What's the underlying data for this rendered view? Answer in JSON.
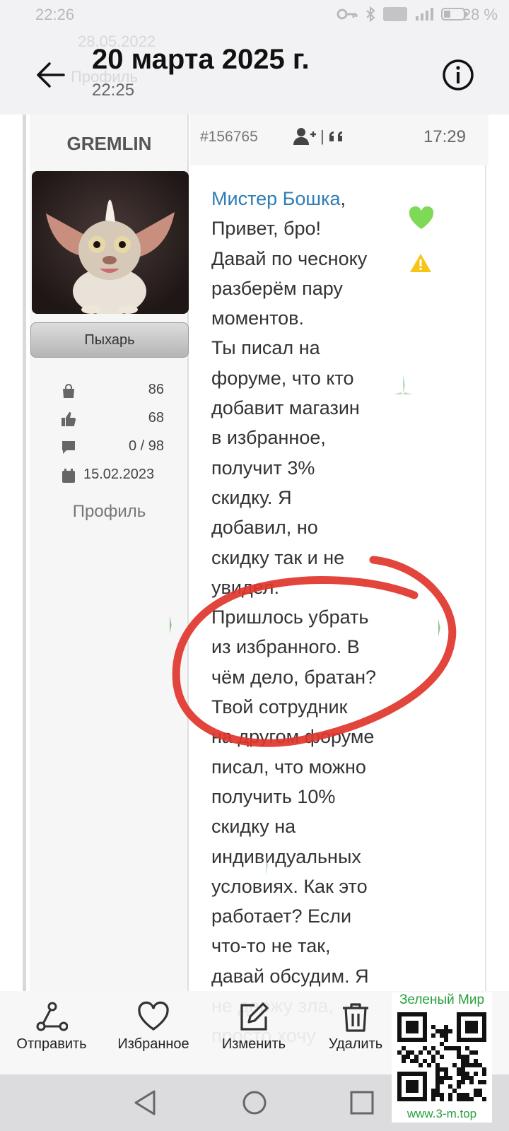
{
  "status_bar": {
    "time": "22:26",
    "battery_percent": "28 %"
  },
  "header": {
    "title": "20 марта 2025 г.",
    "subtitle": "22:25",
    "ghost_date": "28.05.2022",
    "ghost_profile": "Профиль"
  },
  "author": {
    "username": "GREMLIN",
    "rank": "Пыхарь",
    "stats": {
      "purchases": "86",
      "likes": "68",
      "messages": "0 / 98",
      "joined": "15.02.2023"
    },
    "profile_link": "Профиль"
  },
  "post": {
    "id": "#156765",
    "time": "17:29",
    "mention": "Мистер Бошка",
    "lines": [
      "Привет, бро!",
      "Давай по чесноку",
      "разберём пару",
      "моментов.",
      "Ты писал на",
      "форуме, что кто",
      "добавит магазин",
      "в избранное,",
      "получит 3%",
      "скидку. Я",
      "добавил, но",
      "скидку так и не",
      "увидел.",
      "Пришлось убрать",
      "из избранного. В",
      "чём дело, братан?",
      "Твой сотрудник",
      "на другом форуме",
      "писал, что можно",
      "получить 10%",
      "скидку на",
      "индивидуальных",
      "условиях. Как это",
      "работает? Если",
      "что-то не так,",
      "давай обсудим. Я",
      "не держу зла,",
      "просто хочу"
    ]
  },
  "toolbar": {
    "send": "Отправить",
    "favorites": "Избранное",
    "edit": "Изменить",
    "delete": "Удалить"
  },
  "watermark": {
    "title": "Зеленый Мир",
    "url": "www.3-m.top"
  },
  "colors": {
    "accent_link": "#2e7db6",
    "like_green": "#7ed957",
    "warning": "#f5c518",
    "annotation_red": "#e0352b",
    "brand_green": "#27a03b"
  }
}
